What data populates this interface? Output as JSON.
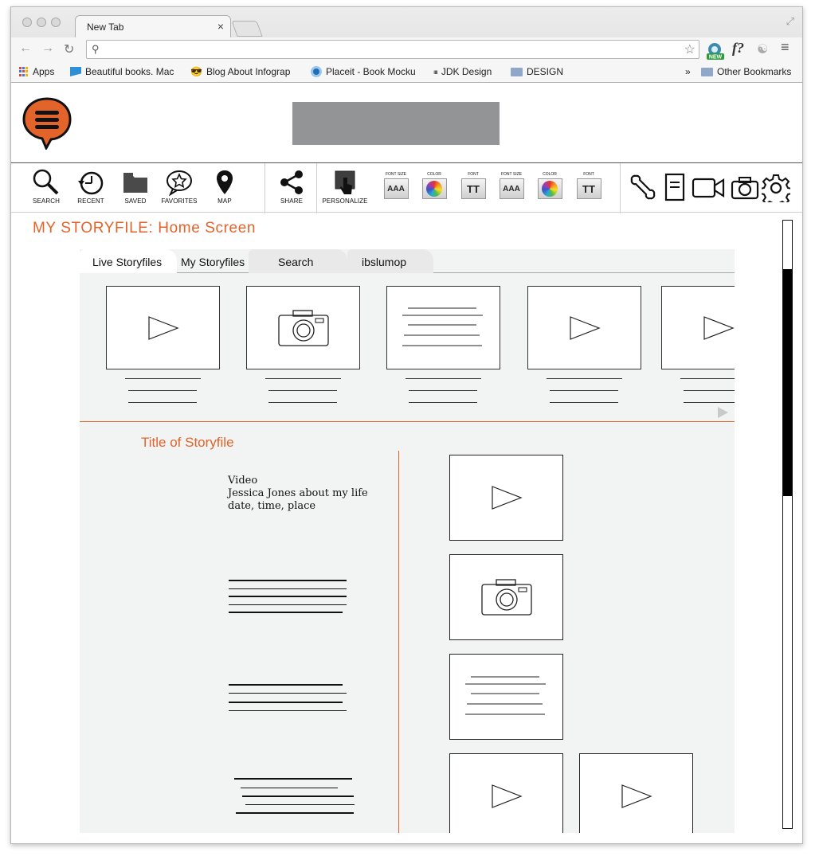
{
  "browser": {
    "tab_title": "New Tab",
    "tab_close": "×",
    "bookmarks": [
      "Apps",
      "Beautiful books. Mac",
      "Blog About Infograp",
      "Placeit - Book Mocku",
      "JDK Design",
      "DESIGN"
    ],
    "bookmarks_overflow": "»",
    "other_bookmarks": "Other Bookmarks",
    "ext_badge": "NEW",
    "ext_f": "f?"
  },
  "toolbar": {
    "tools": [
      "SEARCH",
      "RECENT",
      "SAVED",
      "FAVORITES",
      "MAP",
      "SHARE",
      "PERSONALIZE"
    ],
    "mini_labels": [
      "FONT SIZE",
      "COLOR",
      "FONT",
      "FONT SIZE",
      "COLOR",
      "FONT"
    ],
    "font_size_glyph": "AAA",
    "font_glyph": "TT"
  },
  "page": {
    "title": "MY STORYFILE: Home Screen",
    "tabs": [
      "Live Storyfiles",
      "My Storyfiles",
      "Search",
      "ibslumop"
    ],
    "thumbnails": [
      "video",
      "photo",
      "text",
      "video",
      "video"
    ],
    "story_title": "Title of Storyfile",
    "meta": [
      "Video",
      "Jessica Jones about my life",
      "date, time, place"
    ],
    "media": [
      "video",
      "photo",
      "text",
      "video",
      "video"
    ]
  },
  "colors": {
    "accent": "#e2642a",
    "header_bar": "#939496",
    "panel": "#f2f3f3"
  }
}
